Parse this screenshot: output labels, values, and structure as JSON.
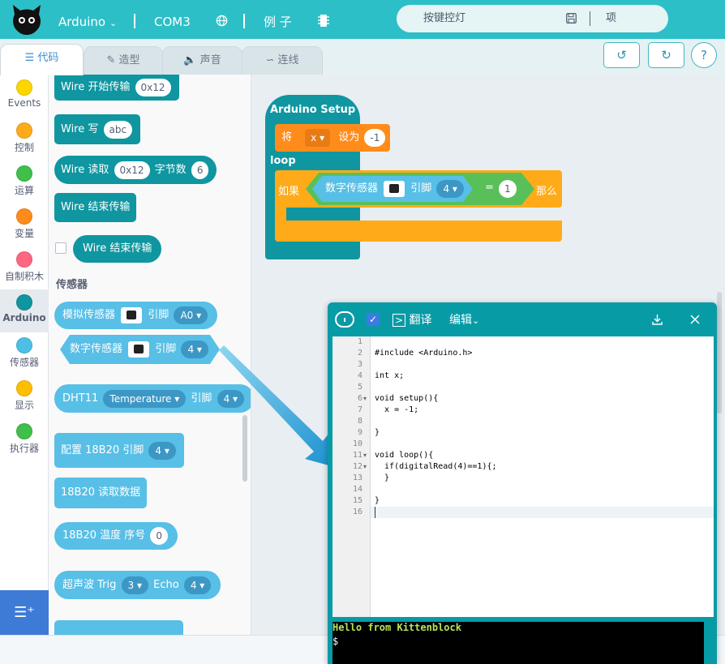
{
  "topbar": {
    "board": "Arduino",
    "port": "COM3",
    "examples": "例 子",
    "project_name": "按键控灯",
    "project_menu": "项目"
  },
  "tabs": [
    {
      "label": "代码",
      "icon": "code-icon"
    },
    {
      "label": "造型",
      "icon": "brush-icon"
    },
    {
      "label": "声音",
      "icon": "speaker-icon"
    },
    {
      "label": "连线",
      "icon": "wire-icon"
    }
  ],
  "toolbar_buttons": {
    "undo": "↺",
    "redo": "↻",
    "help": "?"
  },
  "categories": [
    {
      "label": "Events",
      "color": "#ffd500"
    },
    {
      "label": "控制",
      "color": "#ffab19"
    },
    {
      "label": "运算",
      "color": "#40bf4a"
    },
    {
      "label": "变量",
      "color": "#ff8c1a"
    },
    {
      "label": "自制积木",
      "color": "#ff6680"
    },
    {
      "label": "Arduino",
      "color": "#0f96a0"
    },
    {
      "label": "传感器",
      "color": "#4cbfe6"
    },
    {
      "label": "显示",
      "color": "#ffbf00"
    },
    {
      "label": "执行器",
      "color": "#40bf4a"
    }
  ],
  "palette": {
    "wire_begin": {
      "label": "Wire 开始传输",
      "addr": "0x12"
    },
    "wire_write": {
      "label": "Wire 写",
      "value": "abc"
    },
    "wire_read": {
      "label": "Wire 读取",
      "addr": "0x12",
      "bytes_label": "字节数",
      "bytes": "6"
    },
    "wire_end": {
      "label": "Wire 结束传输"
    },
    "wire_end_reporter": {
      "label": "Wire 结束传输"
    },
    "section_sensors": "传感器",
    "analog_sensor": {
      "label": "模拟传感器",
      "pin_label": "引脚",
      "pin": "A0"
    },
    "digital_sensor": {
      "label": "数字传感器",
      "pin_label": "引脚",
      "pin": "4"
    },
    "dht11": {
      "label": "DHT11",
      "mode": "Temperature",
      "pin_label": "引脚",
      "pin": "4"
    },
    "ds18b20_config": {
      "label": "配置 18B20 引脚",
      "pin": "4"
    },
    "ds18b20_read": {
      "label": "18B20 读取数据"
    },
    "ds18b20_temp": {
      "label": "18B20 温度 序号",
      "index": "0"
    },
    "ultrasonic": {
      "label": "超声波 Trig",
      "trig": "3",
      "echo_label": "Echo",
      "echo": "4"
    }
  },
  "script": {
    "hat": "Arduino Setup",
    "set_label": "将",
    "set_var": "x",
    "set_to": "设为",
    "set_value": "-1",
    "loop": "loop",
    "if_label": "如果",
    "cond_sensor": "数字传感器",
    "cond_pin_label": "引脚",
    "cond_pin": "4",
    "cond_eq": "=",
    "cond_value": "1",
    "then": "那么"
  },
  "code_panel": {
    "translate": "翻译",
    "edit": "编辑",
    "lines": [
      "",
      "#include <Arduino.h>",
      "",
      "int x;",
      "",
      "void setup(){",
      "  x = -1;",
      "",
      "}",
      "",
      "void loop(){",
      "  if(digitalRead(4)==1){;",
      "  }",
      "",
      "}",
      ""
    ],
    "line_numbers": [
      "1",
      "2",
      "3",
      "4",
      "5",
      "6",
      "7",
      "8",
      "9",
      "10",
      "11",
      "12",
      "13",
      "14",
      "15",
      "16"
    ],
    "console_line1": "Hello from Kittenblock",
    "console_line2": "$"
  },
  "icons": {
    "globe": "globe-icon",
    "chip": "chip-icon",
    "save": "save-icon",
    "download": "download-icon",
    "close": "close-icon"
  },
  "colors": {
    "topbar": "#2dbfc7",
    "arduino_block": "#0f96a0",
    "sensor_block": "#58bfe6",
    "control_block": "#ffab19",
    "operator_block": "#59c059",
    "variable_block": "#ff8c1a"
  }
}
